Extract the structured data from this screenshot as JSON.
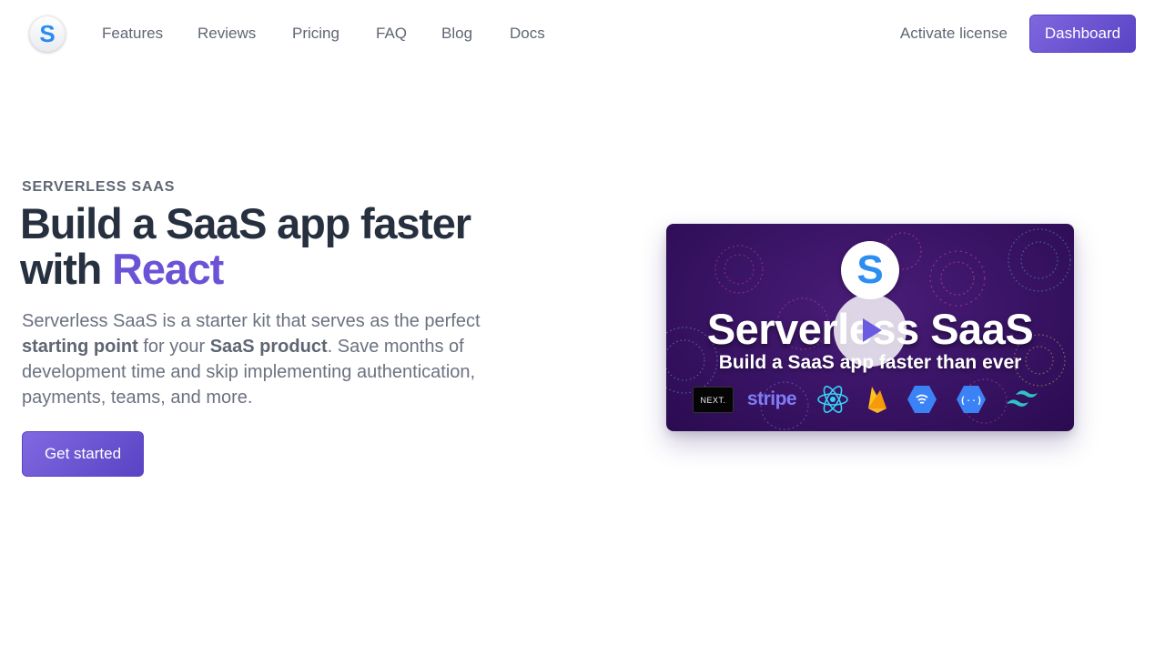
{
  "nav": {
    "logo_letter": "S",
    "links": [
      "Features",
      "Reviews",
      "Pricing",
      "FAQ",
      "Blog",
      "Docs"
    ],
    "activate_label": "Activate license",
    "dashboard_label": "Dashboard"
  },
  "hero": {
    "eyebrow": "SERVERLESS SAAS",
    "headline_line1": "Build a SaaS app faster",
    "headline_with": "with",
    "headline_accent": "React",
    "desc_part1": "Serverless SaaS is a starter kit that serves as the perfect",
    "desc_bold1": "starting point",
    "desc_part2": "for your",
    "desc_bold2": "SaaS product",
    "desc_part3": ". Save months of development time and skip implementing authentication, payments, teams, and more.",
    "cta_label": "Get started"
  },
  "video": {
    "logo_letter": "S",
    "title": "Serverless SaaS",
    "subtitle": "Build a SaaS app faster than ever",
    "next_label": "NEXT.",
    "stripe_label": "stripe"
  },
  "colors": {
    "accent": "#6b52d6",
    "button": "#6a54d2",
    "heading": "#27303f",
    "muted": "#6b7280"
  }
}
